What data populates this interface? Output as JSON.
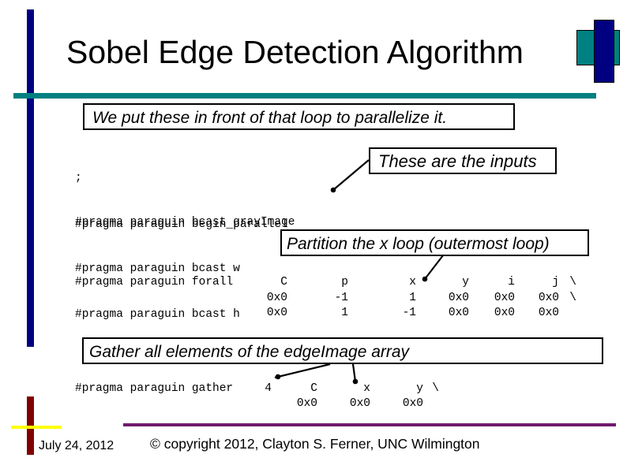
{
  "slide": {
    "title": "Sobel Edge Detection Algorithm",
    "colors": {
      "navy": "#000080",
      "teal": "#008080",
      "maroon": "#800000",
      "yellow": "#ffff00",
      "purple": "#6f1a6f"
    }
  },
  "callouts": {
    "put_in_front": "We put these in front of that loop to parallelize it.",
    "inputs": "These are the inputs",
    "partition": "Partition the x loop (outermost loop)",
    "gather": "Gather all elements of the edgeImage array"
  },
  "code": {
    "lines_top": [
      ";",
      "#pragma paraguin begin_parallel"
    ],
    "lines_bcast": [
      "#pragma paraguin bcast grayImage",
      "#pragma paraguin bcast w",
      "#pragma paraguin bcast h"
    ],
    "forall": {
      "directive": "#pragma paraguin forall",
      "columns": [
        {
          "header": "C",
          "row1": "0x0",
          "row2": "0x0"
        },
        {
          "header": "p",
          "row1": "-1",
          "row2": "1"
        },
        {
          "header": "x",
          "row1": "1",
          "row2": "-1"
        },
        {
          "header": "y",
          "row1": "0x0",
          "row2": "0x0"
        },
        {
          "header": "i",
          "row1": "0x0",
          "row2": "0x0"
        },
        {
          "header": "j",
          "row1": "0x0",
          "row2": "0x0"
        }
      ],
      "continuation_1": "\\",
      "continuation_2": "\\"
    },
    "gather": {
      "directive": "#pragma paraguin gather",
      "count": "4",
      "columns": [
        {
          "header": "C",
          "row1": "0x0"
        },
        {
          "header": "x",
          "row1": "0x0"
        },
        {
          "header": "y",
          "row1": "0x0"
        }
      ],
      "continuation": "\\"
    }
  },
  "footer": {
    "date": "July 24, 2012",
    "copyright": "© copyright 2012, Clayton S. Ferner, UNC Wilmington"
  }
}
